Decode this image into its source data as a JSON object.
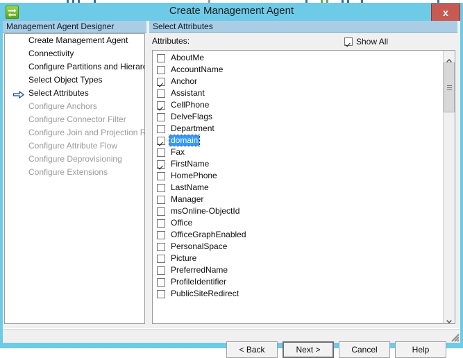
{
  "window": {
    "title": "Create Management Agent",
    "app_icon": "sync-arrows-icon",
    "close_label": "x"
  },
  "left_pane": {
    "header": "Management Agent Designer",
    "steps": [
      {
        "label": "Create Management Agent",
        "enabled": true,
        "current": false
      },
      {
        "label": "Connectivity",
        "enabled": true,
        "current": false
      },
      {
        "label": "Configure Partitions and Hierarchies",
        "enabled": true,
        "current": false
      },
      {
        "label": "Select Object Types",
        "enabled": true,
        "current": false
      },
      {
        "label": "Select Attributes",
        "enabled": true,
        "current": true
      },
      {
        "label": "Configure Anchors",
        "enabled": false,
        "current": false
      },
      {
        "label": "Configure Connector Filter",
        "enabled": false,
        "current": false
      },
      {
        "label": "Configure Join and Projection Rules",
        "enabled": false,
        "current": false
      },
      {
        "label": "Configure Attribute Flow",
        "enabled": false,
        "current": false
      },
      {
        "label": "Configure Deprovisioning",
        "enabled": false,
        "current": false
      },
      {
        "label": "Configure Extensions",
        "enabled": false,
        "current": false
      }
    ]
  },
  "right_pane": {
    "header": "Select Attributes",
    "attributes_label": "Attributes:",
    "show_all": {
      "label": "Show All",
      "checked": true
    },
    "attributes": [
      {
        "name": "AboutMe",
        "checked": false,
        "selected": false
      },
      {
        "name": "AccountName",
        "checked": false,
        "selected": false
      },
      {
        "name": "Anchor",
        "checked": true,
        "selected": false
      },
      {
        "name": "Assistant",
        "checked": false,
        "selected": false
      },
      {
        "name": "CellPhone",
        "checked": true,
        "selected": false
      },
      {
        "name": "DelveFlags",
        "checked": false,
        "selected": false
      },
      {
        "name": "Department",
        "checked": false,
        "selected": false
      },
      {
        "name": "domain",
        "checked": true,
        "selected": true
      },
      {
        "name": "Fax",
        "checked": false,
        "selected": false
      },
      {
        "name": "FirstName",
        "checked": true,
        "selected": false
      },
      {
        "name": "HomePhone",
        "checked": false,
        "selected": false
      },
      {
        "name": "LastName",
        "checked": false,
        "selected": false
      },
      {
        "name": "Manager",
        "checked": false,
        "selected": false
      },
      {
        "name": "msOnline-ObjectId",
        "checked": false,
        "selected": false
      },
      {
        "name": "Office",
        "checked": false,
        "selected": false
      },
      {
        "name": "OfficeGraphEnabled",
        "checked": false,
        "selected": false
      },
      {
        "name": "PersonalSpace",
        "checked": false,
        "selected": false
      },
      {
        "name": "Picture",
        "checked": false,
        "selected": false
      },
      {
        "name": "PreferredName",
        "checked": false,
        "selected": false
      },
      {
        "name": "ProfileIdentifier",
        "checked": false,
        "selected": false
      },
      {
        "name": "PublicSiteRedirect",
        "checked": false,
        "selected": false
      }
    ],
    "scrollbar": {
      "up_icon": "chevron-up-icon",
      "down_icon": "chevron-down-icon",
      "thumb_top_pct": 4,
      "thumb_height_pct": 18
    }
  },
  "buttons": {
    "back": "< Back",
    "next": "Next >",
    "cancel": "Cancel",
    "help": "Help"
  },
  "colors": {
    "window_frame": "#6ecbe8",
    "pane_header": "#a8cde4",
    "selection": "#3399ff",
    "close_button": "#c75b54",
    "dialog_face": "#f0f0f0"
  }
}
